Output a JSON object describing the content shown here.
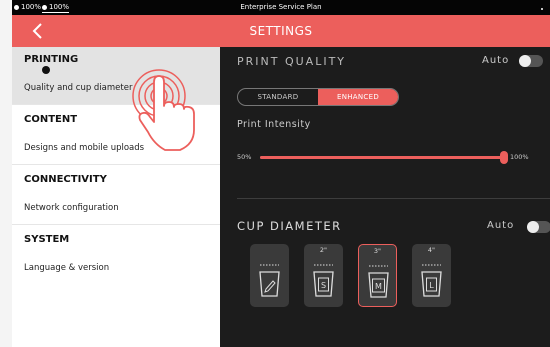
{
  "status_bar": {
    "battery_1": "100%",
    "battery_2": "100%",
    "title": "Enterprise Service Plan"
  },
  "header": {
    "back_icon": "chevron-left-icon",
    "title": "SETTINGS"
  },
  "sidebar": {
    "sections": [
      {
        "heading": "PRINTING",
        "item": "Quality and cup diameter"
      },
      {
        "heading": "CONTENT",
        "item": "Designs and mobile uploads"
      },
      {
        "heading": "CONNECTIVITY",
        "item": "Network configuration"
      },
      {
        "heading": "SYSTEM",
        "item": "Language & version"
      }
    ]
  },
  "print_quality": {
    "title": "PRINT QUALITY",
    "auto_label": "Auto",
    "auto_enabled": false,
    "options": [
      "STANDARD",
      "ENHANCED"
    ],
    "selected": "ENHANCED"
  },
  "print_intensity": {
    "label": "Print Intensity",
    "min_label": "50%",
    "max_label": "100%",
    "value_percent": 100
  },
  "cup_diameter": {
    "title": "CUP DIAMETER",
    "auto_label": "Auto",
    "auto_enabled": false,
    "cups": [
      {
        "size_label": "",
        "letter": "",
        "icon": "pencil-icon"
      },
      {
        "size_label": "2\"",
        "letter": "S"
      },
      {
        "size_label": "3\"",
        "letter": "M"
      },
      {
        "size_label": "4\"",
        "letter": "L"
      }
    ],
    "selected_index": 2
  },
  "colors": {
    "accent": "#ec5f5c",
    "panel_bg": "#1c1c1c",
    "sidebar_bg": "#ffffff"
  }
}
